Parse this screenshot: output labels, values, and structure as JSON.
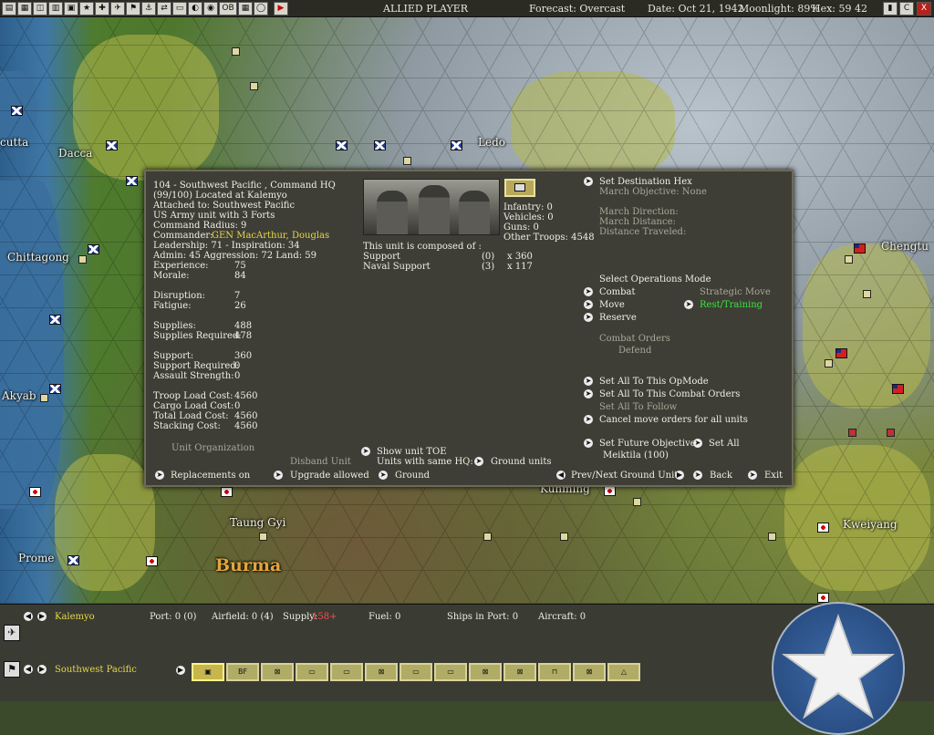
{
  "topbar": {
    "player": "ALLIED PLAYER",
    "forecast": "Forecast: Overcast",
    "date": "Date: Oct 21, 1942",
    "moonlight": "Moonlight: 89%",
    "hex": "Hex: 59 42",
    "right_buttons": [
      "▮",
      "C",
      "X"
    ],
    "left_buttons": [
      "▤",
      "▦",
      "◫",
      "▥",
      "▣",
      "★",
      "✚",
      "✈",
      "⚑",
      "⚓",
      "⇄",
      "▭",
      "◐",
      "◉",
      "OB",
      "▦",
      "◯",
      "▶"
    ]
  },
  "map": {
    "labels": [
      "Dacca",
      "Calcutta",
      "Chittagong",
      "Akyab",
      "Prome",
      "Taung Gyi",
      "Burma",
      "Ledo",
      "Chengtu",
      "Kunming",
      "Kweiyang"
    ],
    "calcutta_visible": "cutta"
  },
  "dialog": {
    "header": {
      "line1": "104 - Southwest Pacific , Command HQ",
      "line2": "(99/100) Located at Kalemyo",
      "line3": "Attached to: Southwest Pacific",
      "line4": "US Army unit with 3 Forts",
      "line5": " Command Radius: 9",
      "commander_label": "Commander:",
      "commander_name": "GEN MacArthur, Douglas",
      "leadership": "Leadership: 71 - Inspiration: 34",
      "admin": "  Admin: 45  Aggression: 72 Land: 59"
    },
    "stats": [
      {
        "label": "Experience:",
        "value": "75"
      },
      {
        "label": "Morale:",
        "value": "84"
      },
      {
        "label": "Disruption:",
        "value": "7"
      },
      {
        "label": "Fatigue:",
        "value": "26"
      },
      {
        "label": "Supplies:",
        "value": "488"
      },
      {
        "label": "Supplies Required:",
        "value": "478"
      },
      {
        "label": "Support:",
        "value": "360"
      },
      {
        "label": "Support Required:",
        "value": "0"
      },
      {
        "label": "Assault Strength:",
        "value": "0"
      },
      {
        "label": "Troop Load Cost:",
        "value": "4560"
      },
      {
        "label": "Cargo Load Cost:",
        "value": "0"
      },
      {
        "label": "Total Load Cost:",
        "value": "4560"
      },
      {
        "label": "Stacking Cost:",
        "value": "4560"
      }
    ],
    "composition": {
      "infantry": "Infantry: 0",
      "vehicles": "Vehicles: 0",
      "guns": "Guns: 0",
      "other_troops": "Other Troops: 4548",
      "intro": "This unit is composed of :",
      "rows": [
        {
          "name": "Support",
          "count": "(0)",
          "qty": "x 360"
        },
        {
          "name": "Naval Support",
          "count": "(3)",
          "qty": "x 117"
        }
      ]
    },
    "orders": {
      "set_destination": "Set Destination Hex",
      "march_objective": "March Objective: None",
      "march_direction": "March Direction:",
      "march_distance": "March Distance:",
      "distance_traveled": "Distance Traveled:",
      "select_mode": "Select Operations Mode",
      "combat": "Combat",
      "strategic_move": "Strategic Move",
      "move": "Move",
      "rest_training": "Rest/Training",
      "reserve": "Reserve",
      "combat_orders": "Combat Orders",
      "defend": "Defend",
      "set_all_opmode": "Set All To This OpMode",
      "set_all_combat": "Set All To This Combat Orders",
      "set_all_follow": "Set All To Follow",
      "cancel_move": "Cancel move orders for all units",
      "set_future_objective": "Set Future Objective",
      "set_all": "Set All",
      "future_target": "Meiktila (100)"
    },
    "footer": {
      "unit_org": "Unit Organization",
      "disband": "Disband Unit",
      "show_toe": "Show unit TOE",
      "same_hq": "Units with same HQ:",
      "ground_units": "Ground units",
      "replacements": "Replacements on",
      "upgrade": "Upgrade allowed",
      "ground": "Ground",
      "prev_next": "Prev/Next Ground Unit",
      "back": "Back",
      "exit": "Exit"
    }
  },
  "bottombar": {
    "location": "Kalemyo",
    "port": "Port: 0 (0)",
    "airfield": "Airfield: 0 (4)",
    "supply_label": "Supply:",
    "supply_value": "158+",
    "fuel": "Fuel: 0",
    "ships": "Ships in Port: 0",
    "aircraft": "Aircraft: 0",
    "hq": "Southwest Pacific",
    "unit_buttons": [
      "▣",
      "BF",
      "⊠",
      "▭",
      "▭",
      "⊠",
      "▭",
      "▭",
      "⊠",
      "⊠",
      "⊓",
      "⊠",
      "△"
    ]
  },
  "colors": {
    "accent_yellow": "#e5d94a",
    "rest_green": "#37e63c",
    "supply_red": "#ff4a4a",
    "dialog_bg": "#3f3e36"
  }
}
